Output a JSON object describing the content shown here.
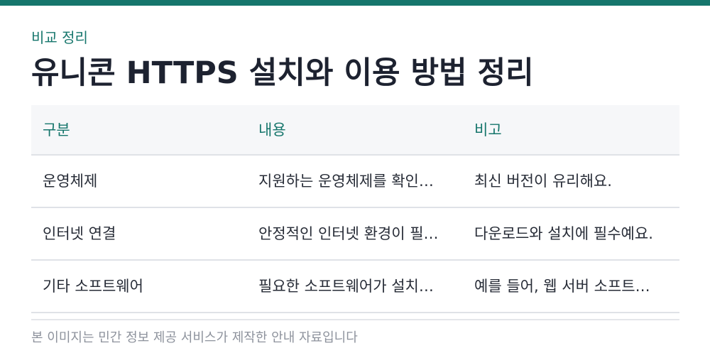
{
  "header": {
    "eyebrow": "비교 정리",
    "title": "유니콘 HTTPS 설치와 이용 방법 정리"
  },
  "table": {
    "columns": [
      "구분",
      "내용",
      "비고"
    ],
    "rows": [
      [
        "운영체제",
        "지원하는 운영체제를 확인…",
        "최신 버전이 유리해요."
      ],
      [
        "인터넷 연결",
        "안정적인 인터넷 환경이 필…",
        "다운로드와 설치에 필수예요."
      ],
      [
        "기타 소프트웨어",
        "필요한 소프트웨어가 설치…",
        "예를 들어, 웹 서버 소프트…"
      ]
    ]
  },
  "footer": {
    "note": "본 이미지는 민간 정보 제공 서비스가 제작한 안내 자료입니다"
  },
  "colors": {
    "accent": "#16766c",
    "header_bg": "#f6f7f9",
    "divider": "#dfe2e7"
  }
}
